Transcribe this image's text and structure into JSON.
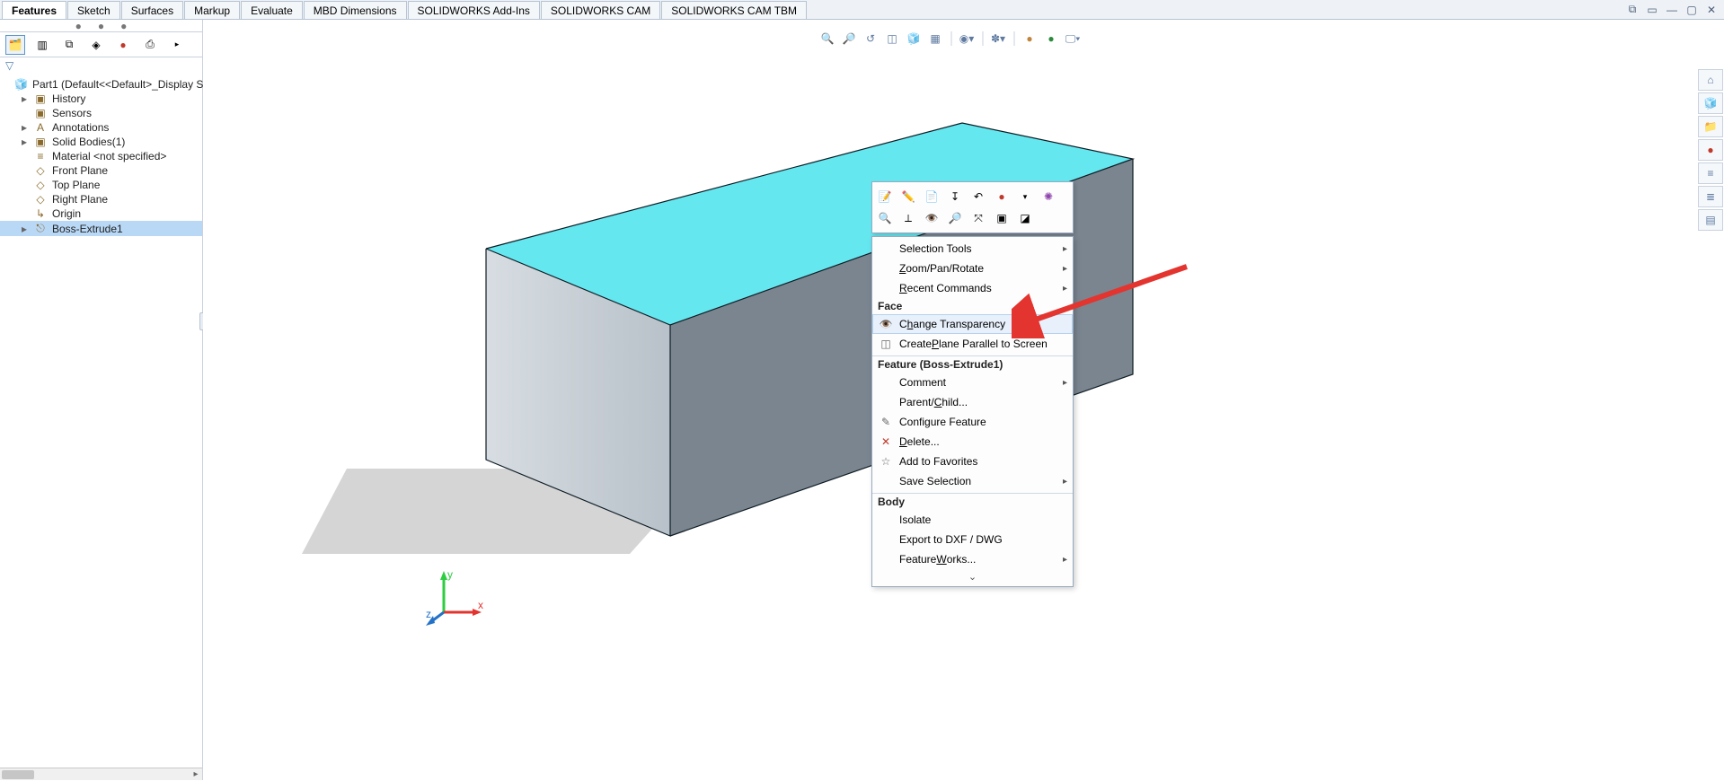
{
  "ribbon": {
    "tabs": [
      "Features",
      "Sketch",
      "Surfaces",
      "Markup",
      "Evaluate",
      "MBD Dimensions",
      "SOLIDWORKS Add-Ins",
      "SOLIDWORKS CAM",
      "SOLIDWORKS CAM TBM"
    ],
    "active_index": 0
  },
  "tree": {
    "root": "Part1  (Default<<Default>_Display S",
    "items": [
      {
        "label": "History",
        "glyph": "▣",
        "expandable": true
      },
      {
        "label": "Sensors",
        "glyph": "▣",
        "expandable": false
      },
      {
        "label": "Annotations",
        "glyph": "A",
        "expandable": true
      },
      {
        "label": "Solid Bodies(1)",
        "glyph": "▣",
        "expandable": true
      },
      {
        "label": "Material <not specified>",
        "glyph": "≡",
        "expandable": false
      },
      {
        "label": "Front Plane",
        "glyph": "◇",
        "expandable": false
      },
      {
        "label": "Top Plane",
        "glyph": "◇",
        "expandable": false
      },
      {
        "label": "Right Plane",
        "glyph": "◇",
        "expandable": false
      },
      {
        "label": "Origin",
        "glyph": "↳",
        "expandable": false
      },
      {
        "label": "Boss-Extrude1",
        "glyph": "⎋",
        "expandable": true,
        "selected": true
      }
    ]
  },
  "context_menu": {
    "groups": [
      {
        "header": null,
        "items": [
          {
            "label": "Selection Tools",
            "submenu": true
          },
          {
            "label": "Zoom/Pan/Rotate",
            "submenu": true,
            "ukey": "Z"
          },
          {
            "label": "Recent Commands",
            "submenu": true,
            "ukey": "R"
          }
        ]
      },
      {
        "header": "Face",
        "items": [
          {
            "label": "Change Transparency",
            "icon": "eye",
            "highlight": true,
            "ukey": "h"
          },
          {
            "label": "Create Plane Parallel to Screen",
            "icon": "plane",
            "ukey": "P"
          }
        ]
      },
      {
        "header": "Feature (Boss-Extrude1)",
        "items": [
          {
            "label": "Comment",
            "submenu": true
          },
          {
            "label": "Parent/Child...",
            "ukey": "C"
          },
          {
            "label": "Configure Feature",
            "icon": "pencil"
          },
          {
            "label": "Delete...",
            "icon": "x",
            "ukey": "D"
          },
          {
            "label": "Add to Favorites",
            "icon": "star"
          },
          {
            "label": "Save Selection",
            "submenu": true
          }
        ]
      },
      {
        "header": "Body",
        "items": [
          {
            "label": "Isolate"
          },
          {
            "label": "Export to DXF / DWG"
          },
          {
            "label": "FeatureWorks...",
            "submenu": true,
            "ukey": "W"
          }
        ]
      }
    ]
  },
  "headsup_icons": [
    "zoom-fit",
    "zoom-area",
    "zoom-prev",
    "section",
    "view-orient",
    "display-style",
    "hide-show",
    "edit-appearance",
    "apply-scene",
    "view-settings",
    "render",
    "screen"
  ],
  "taskpane_icons": [
    "home",
    "resources",
    "props",
    "appearances",
    "library",
    "forum",
    "views",
    "monitor"
  ],
  "ctx_toolbar_row1": [
    "edit-feature",
    "edit-sketch",
    "feat-prop",
    "suppress",
    "rollback",
    "appearance",
    "dropdown",
    "appearance2"
  ],
  "ctx_toolbar_row2": [
    "zoom-sel",
    "normal-to",
    "hide",
    "zoom",
    "isolate",
    "box",
    "transp"
  ],
  "triad": {
    "x": "x",
    "y": "y",
    "z": "z"
  }
}
